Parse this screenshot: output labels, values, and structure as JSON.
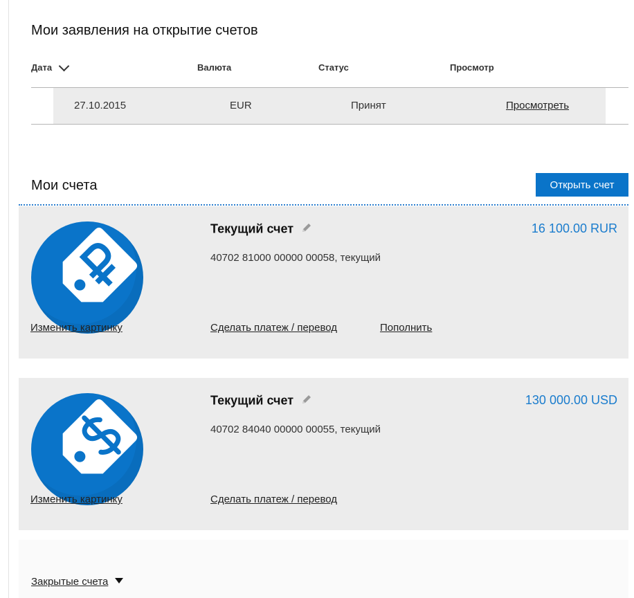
{
  "applications": {
    "title": "Мои заявления на открытие счетов",
    "columns": {
      "date": "Дата",
      "currency": "Валюта",
      "status": "Статус",
      "view": "Просмотр"
    },
    "rows": [
      {
        "date": "27.10.2015",
        "currency": "EUR",
        "status": "Принят",
        "view_link": "Просмотреть"
      }
    ]
  },
  "accounts": {
    "title": "Мои счета",
    "open_button": "Открыть счет",
    "items": [
      {
        "title": "Текущий счет",
        "number": "40702 81000 00000 00058, текущий",
        "amount": "16 100.00 RUR",
        "icon": "ruble-tag-icon",
        "change_picture": "Изменить картинку",
        "actions": [
          "Сделать платеж / перевод",
          "Пополнить"
        ]
      },
      {
        "title": "Текущий счет",
        "number": "40702 84040 00000 00055, текущий",
        "amount": "130 000.00 USD",
        "icon": "dollar-tag-icon",
        "change_picture": "Изменить картинку",
        "actions": [
          "Сделать платеж / перевод"
        ]
      }
    ],
    "closed_label": "Закрытые счета"
  },
  "colors": {
    "accent": "#0a74c9",
    "amount": "#1a7ccd",
    "card_bg": "#ececec"
  }
}
